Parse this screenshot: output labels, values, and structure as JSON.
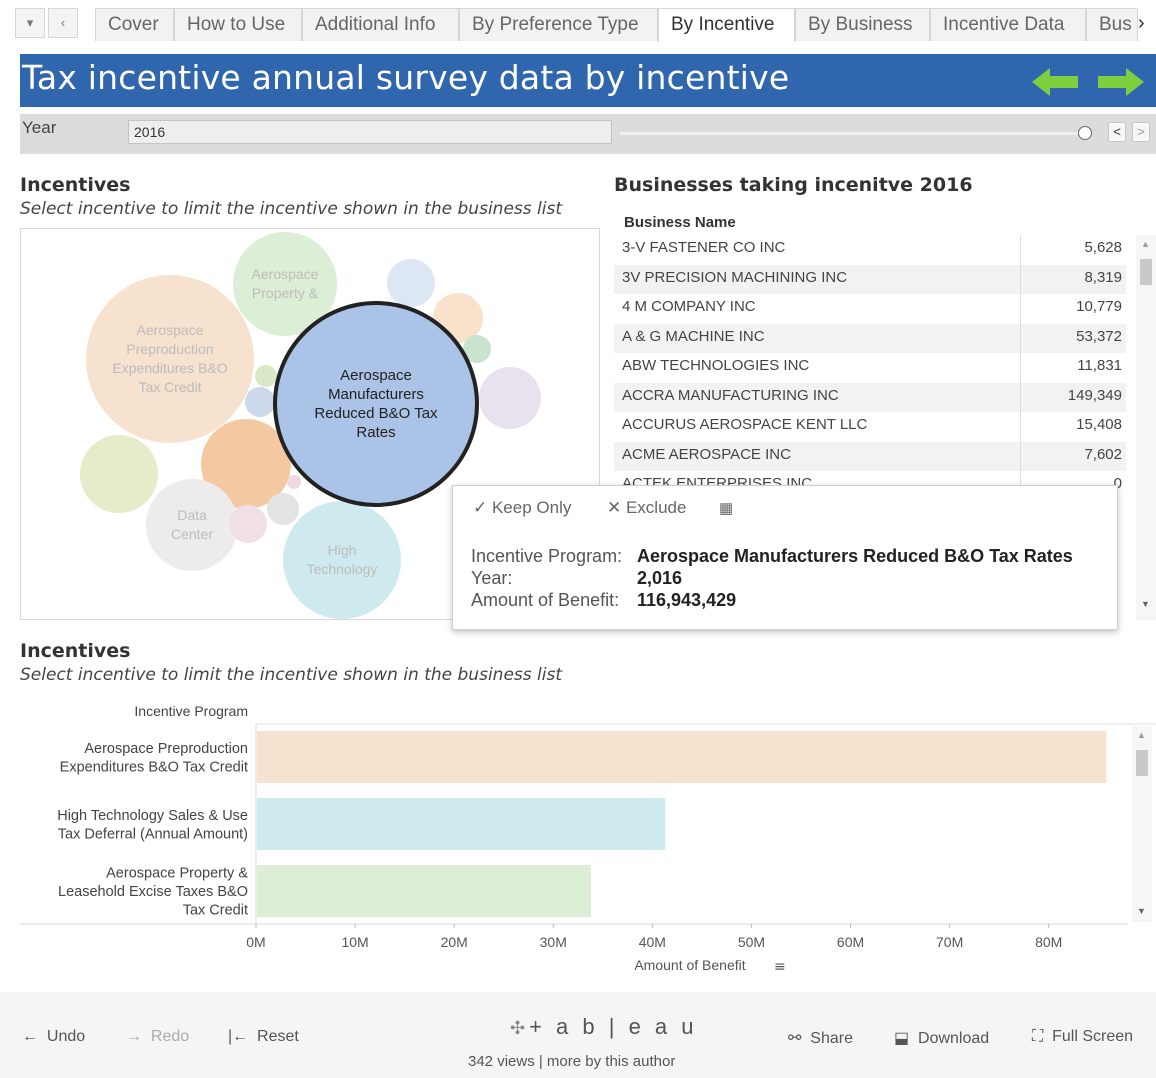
{
  "tabs": {
    "nav_prev": "◀",
    "nav_back": "‹",
    "items": [
      "Cover",
      "How to Use",
      "Additional Info",
      "By Preference Type",
      "By Incentive",
      "By Business",
      "Incentive Data",
      "Bus"
    ],
    "active": "By Incentive",
    "more": "›"
  },
  "header": {
    "title": "Tax incentive annual survey data by incentive",
    "accent_color": "#2f66ad",
    "arrow_color": "#7dcf3d"
  },
  "filter": {
    "label": "Year",
    "value": "2016",
    "prev": "<",
    "next": ">"
  },
  "bubbles_section": {
    "title": "Incentives",
    "subtitle": "Select incentive to limit the incentive shown in the business list",
    "bubbles": [
      {
        "label": "Aerospace Preproduction Expenditures B&O Tax Credit",
        "color": "#f7e1cf"
      },
      {
        "label": "Aerospace Property &",
        "color": "#dceed6"
      },
      {
        "label": "Aerospace Manufacturers Reduced B&O Tax Rates",
        "color": "#aac3e6",
        "selected": true
      },
      {
        "label": "Data Center",
        "color": "#ececec"
      },
      {
        "label": "High Technology",
        "color": "#cfeaee"
      },
      {
        "label": "",
        "color": "#e6ebc9"
      },
      {
        "label": "",
        "color": "#f4c9a2"
      },
      {
        "label": "",
        "color": "#e8e2ee"
      },
      {
        "label": "",
        "color": "#dde6f3"
      },
      {
        "label": "",
        "color": "#f8e2cc"
      },
      {
        "label": "",
        "color": "#c9e3cf"
      },
      {
        "label": "",
        "color": "#ccd9ea"
      },
      {
        "label": "",
        "color": "#d9e8c5"
      },
      {
        "label": "",
        "color": "#f1dfe6"
      },
      {
        "label": "",
        "color": "#e3e3e3"
      }
    ]
  },
  "business_table": {
    "title": "Businesses taking incenitve 2016",
    "column_header": "Business Name",
    "rows": [
      {
        "name": "3-V FASTENER CO INC",
        "value": "5,628"
      },
      {
        "name": "3V PRECISION MACHINING INC",
        "value": "8,319"
      },
      {
        "name": "4 M COMPANY INC",
        "value": "10,779"
      },
      {
        "name": "A & G MACHINE INC",
        "value": "53,372"
      },
      {
        "name": "ABW TECHNOLOGIES INC",
        "value": "11,831"
      },
      {
        "name": "ACCRA MANUFACTURING INC",
        "value": "149,349"
      },
      {
        "name": "ACCURUS AEROSPACE KENT LLC",
        "value": "15,408"
      },
      {
        "name": "ACME AEROSPACE INC",
        "value": "7,602"
      },
      {
        "name": "ACTEK ENTERPRISES INC",
        "value": "0"
      }
    ]
  },
  "tooltip": {
    "keep_only": "Keep Only",
    "exclude": "Exclude",
    "fields": [
      {
        "label": "Incentive Program:",
        "value": "Aerospace Manufacturers Reduced B&O Tax Rates"
      },
      {
        "label": "Year:",
        "value": "2,016"
      },
      {
        "label": "Amount of Benefit:",
        "value": "116,943,429"
      }
    ]
  },
  "bar_section": {
    "title": "Incentives",
    "subtitle": "Select incentive to limit the incentive shown in the business list"
  },
  "chart_data": {
    "type": "bar",
    "orientation": "horizontal",
    "row_header": "Incentive Program",
    "categories": [
      [
        "Aerospace Preproduction",
        "Expenditures B&O Tax Credit"
      ],
      [
        "High Technology Sales & Use",
        "Tax Deferral (Annual Amount)"
      ],
      [
        "Aerospace Property &",
        "Leasehold Excise Taxes B&O",
        "Tax Credit"
      ]
    ],
    "values": [
      85700000,
      41200000,
      33700000
    ],
    "colors": [
      "#f7e1cf",
      "#cfeaee",
      "#dceed6"
    ],
    "xlabel": "Amount of Benefit",
    "xlim": [
      0,
      88000000
    ],
    "ticks": [
      0,
      10000000,
      20000000,
      30000000,
      40000000,
      50000000,
      60000000,
      70000000,
      80000000
    ],
    "tick_labels": [
      "0M",
      "10M",
      "20M",
      "30M",
      "40M",
      "50M",
      "60M",
      "70M",
      "80M"
    ]
  },
  "footer": {
    "undo": "Undo",
    "redo": "Redo",
    "reset": "Reset",
    "logo": "+ a b | e a u",
    "views": "342 views | more by this author",
    "share": "Share",
    "download": "Download",
    "fullscreen": "Full Screen"
  }
}
